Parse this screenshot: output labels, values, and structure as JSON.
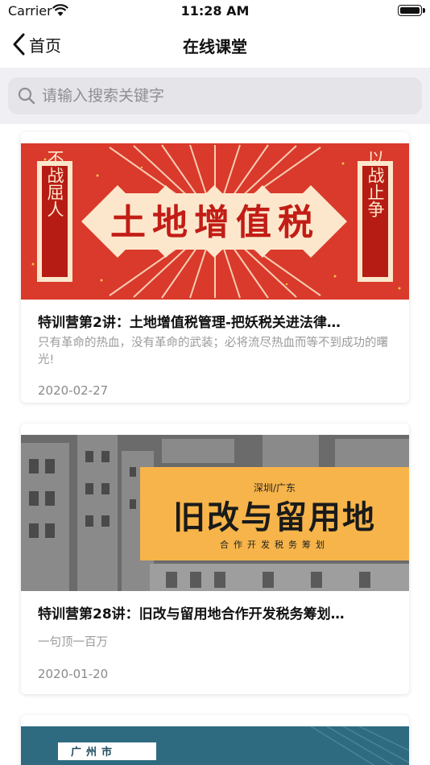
{
  "status_bar": {
    "carrier": "Carrier",
    "time": "11:28 AM"
  },
  "nav": {
    "back_label": "首页",
    "title": "在线课堂"
  },
  "search": {
    "placeholder": "请输入搜索关键字"
  },
  "courses": [
    {
      "banner": {
        "left_text": "不战屈人",
        "main_text": "土地增值税",
        "right_text": "以战止争"
      },
      "title": "特训营第2讲：土地增值税管理-把妖税关进法律…",
      "description": "只有革命的热血，没有革命的武装；必将流尽热血而等不到成功的曙光!",
      "date": "2020-02-27"
    },
    {
      "banner": {
        "tag": "深圳/广东",
        "main_text": "旧改与留用地",
        "sub_text": "合作开发税务筹划"
      },
      "title": "特训营第28讲：旧改与留用地合作开发税务筹划…",
      "description": "一句顶一百万",
      "date": "2020-01-20"
    },
    {
      "banner": {
        "tag": "广州市"
      }
    }
  ],
  "colors": {
    "banner_red": "#d93a2b",
    "banner_dark_red": "#b71c14",
    "banner_cream": "#fde7cc",
    "banner_orange": "#f6b44a",
    "banner_teal": "#2f6b80"
  }
}
